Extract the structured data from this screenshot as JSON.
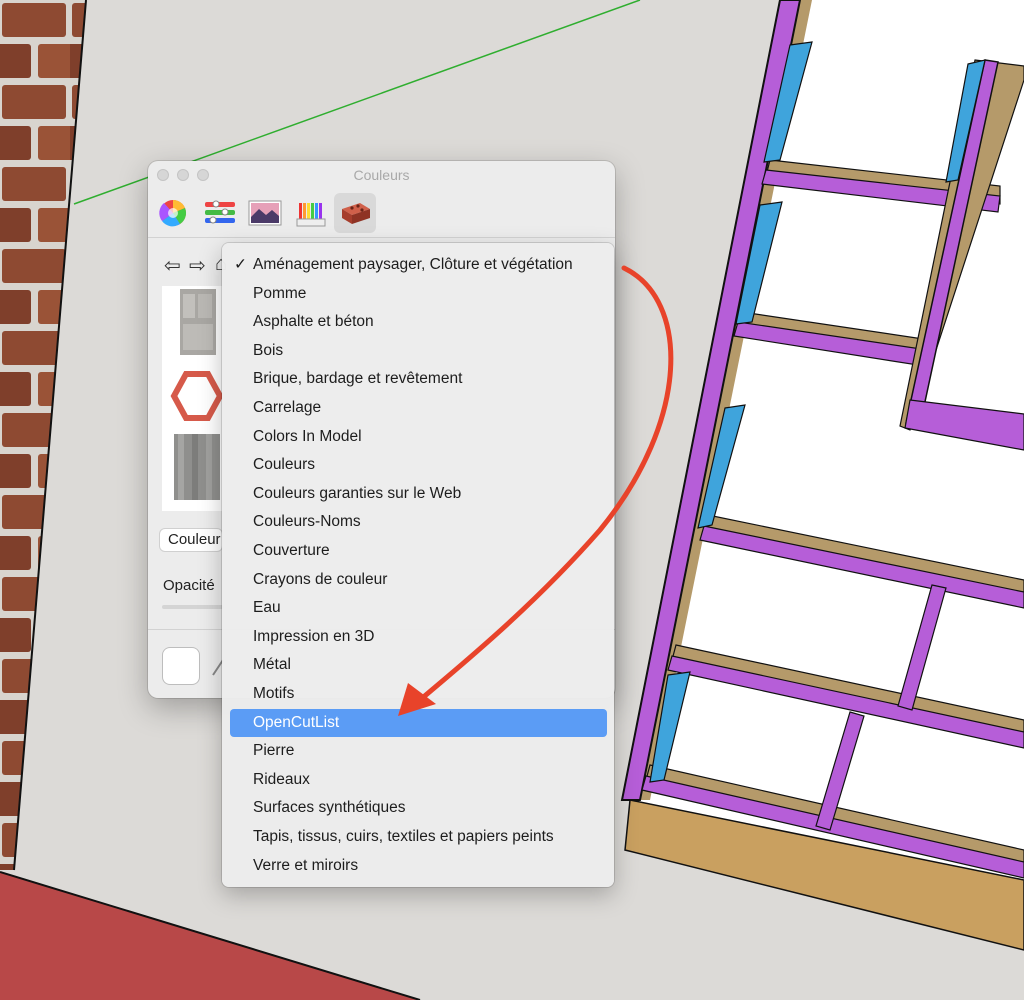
{
  "window": {
    "title": "Couleurs",
    "toolbar": [
      {
        "name": "color-wheel",
        "icon": "color-wheel-icon"
      },
      {
        "name": "color-sliders",
        "icon": "sliders-icon"
      },
      {
        "name": "color-palettes",
        "icon": "image-palette-icon"
      },
      {
        "name": "crayons",
        "icon": "crayons-icon"
      },
      {
        "name": "texture-materials",
        "icon": "brick-icon",
        "selected": true
      }
    ],
    "nav": {
      "back": "⇦",
      "forward": "⇨",
      "home": "⌂"
    },
    "material_name_partial": "Couleur",
    "opacity_label": "Opacité"
  },
  "dropdown": {
    "checked_index": 0,
    "highlighted_index": 16,
    "items": [
      "Aménagement paysager, Clôture et végétation",
      "Pomme",
      "Asphalte et béton",
      "Bois",
      "Brique, bardage et revêtement",
      "Carrelage",
      "Colors In Model",
      "Couleurs",
      "Couleurs garanties sur le Web",
      "Couleurs-Noms",
      "Couverture",
      "Crayons de couleur",
      "Eau",
      "Impression en 3D",
      "Métal",
      "Motifs",
      "OpenCutList",
      "Pierre",
      "Rideaux",
      "Surfaces synthétiques",
      "Tapis, tissus, cuirs, textiles et papiers peints",
      "Verre et miroirs"
    ]
  },
  "colors": {
    "highlight": "#5b9cf5",
    "annotation_arrow": "#e8432a",
    "frame_purple": "#b65ed8",
    "panel_blue": "#3fa4dc",
    "shelf_wood": "#b59a6a"
  }
}
